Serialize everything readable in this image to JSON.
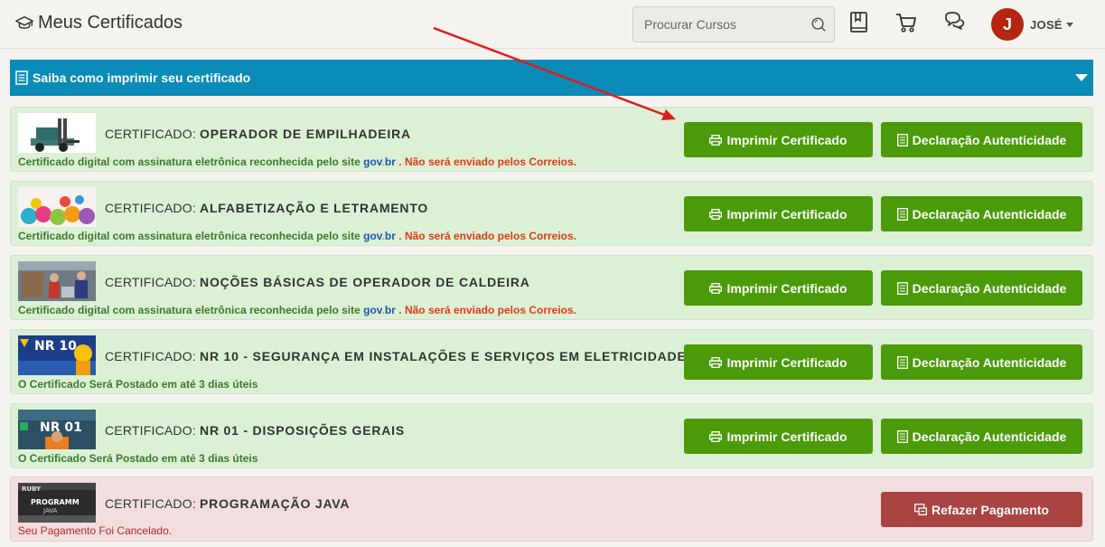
{
  "header": {
    "title": "Meus Certificados",
    "search_placeholder": "Procurar Cursos",
    "user_initial": "J",
    "user_name": "JOSÉ"
  },
  "infobar": {
    "label": "Saiba como imprimir seu certificado"
  },
  "labels": {
    "prefix": "CERTIFICADO:",
    "print": "Imprimir Certificado",
    "authenticity": "Declaração Autenticidade",
    "repay": "Refazer Pagamento",
    "digital_note": "Certificado digital com assinatura eletrônica reconhecida pelo site",
    "gov_a": "gov",
    "gov_b": ".",
    "gov_c": "br",
    "dot": ".",
    "not_mailed": "Não será enviado pelos Correios.",
    "posted_note": "O Certificado Será Postado em até 3 dias úteis",
    "cancel_note": "Seu Pagamento Foi Cancelado."
  },
  "thumb_text": {
    "nr10": "NR 10",
    "nr01": "NR 01",
    "java_a": "RUBY",
    "java_b": "PROGRAMM",
    "java_c": "JAVA"
  },
  "certificates": [
    {
      "name": "OPERADOR DE EMPILHADEIRA",
      "status": "digital"
    },
    {
      "name": "ALFABETIZAÇÃO E LETRAMENTO",
      "status": "digital"
    },
    {
      "name": "NOÇÕES BÁSICAS DE OPERADOR DE CALDEIRA",
      "status": "digital"
    },
    {
      "name": "NR 10 - SEGURANÇA EM INSTALAÇÕES E SERVIÇOS EM ELETRICIDADE",
      "status": "posted"
    },
    {
      "name": "NR 01 - DISPOSIÇÕES GERAIS",
      "status": "posted"
    },
    {
      "name": "PROGRAMAÇÃO JAVA",
      "status": "cancelled"
    }
  ],
  "colors": {
    "green_button": "#4b9a0a",
    "red_button": "#a94442",
    "info_bar": "#0b8bb8",
    "card_green": "#dcf0d6",
    "card_red": "#f2dede"
  }
}
